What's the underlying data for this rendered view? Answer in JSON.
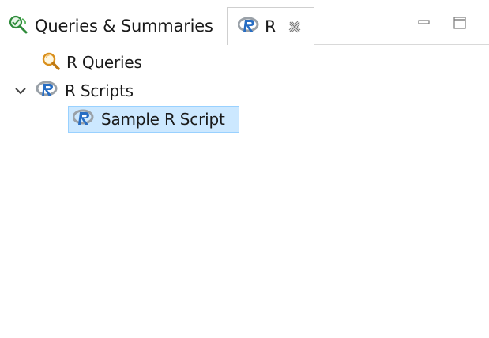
{
  "tabs": [
    {
      "label": "Queries & Summaries",
      "icon": "queries-summaries-icon",
      "active": false
    },
    {
      "label": "R",
      "icon": "r-logo-icon",
      "active": true
    }
  ],
  "tree": {
    "items": [
      {
        "label": "R Queries",
        "icon": "magnifier-icon",
        "level": 1
      },
      {
        "label": "R Scripts",
        "icon": "r-logo-icon",
        "level": 0,
        "expanded": true
      },
      {
        "label": "Sample R Script",
        "icon": "r-logo-icon",
        "level": 2,
        "selected": true
      }
    ]
  },
  "colors": {
    "selection_bg": "#cce8ff",
    "selection_border": "#99d1ff",
    "r_blue": "#276dc3",
    "r_gray": "#9aa1a8",
    "queries_green": "#2e8b3a",
    "magnifier_orange": "#d98f1b"
  }
}
